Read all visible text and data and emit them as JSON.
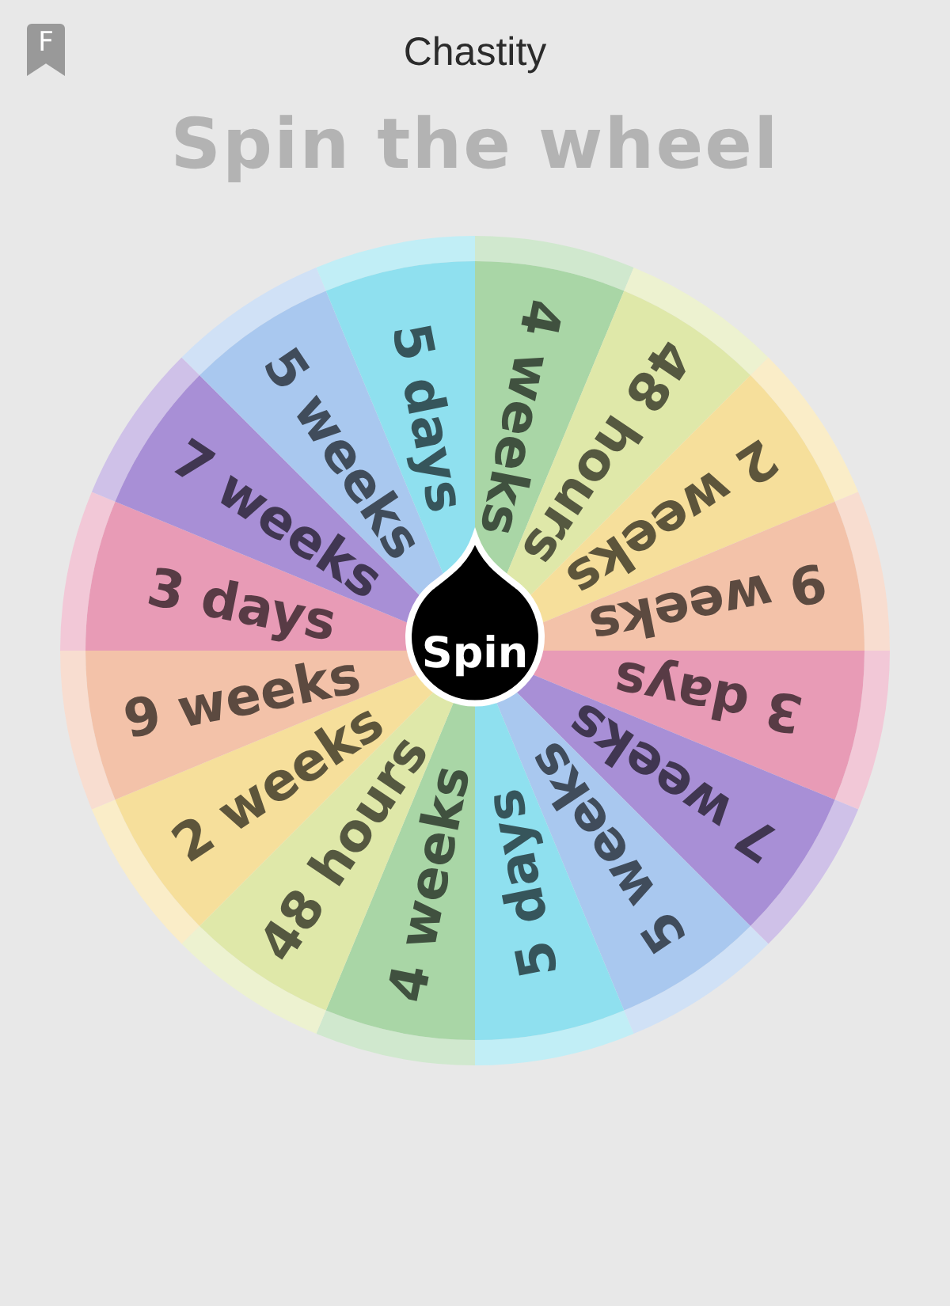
{
  "header": {
    "badge": "F",
    "title": "Chastity"
  },
  "heading": "Spin the wheel",
  "wheel": {
    "button": "Spin",
    "segments": [
      {
        "label": "4 weeks",
        "color": "#a9d6a6"
      },
      {
        "label": "48 hours",
        "color": "#dfe8a9"
      },
      {
        "label": "2 weeks",
        "color": "#f6df9b"
      },
      {
        "label": "9 weeks",
        "color": "#f3c2a9"
      },
      {
        "label": "3 days",
        "color": "#e89bb6"
      },
      {
        "label": "7 weeks",
        "color": "#a88fd6"
      },
      {
        "label": "5 weeks",
        "color": "#a9c8ef"
      },
      {
        "label": "5 days",
        "color": "#8fe0ef"
      },
      {
        "label": "4 weeks",
        "color": "#a9d6a6"
      },
      {
        "label": "48 hours",
        "color": "#dfe8a9"
      },
      {
        "label": "2 weeks",
        "color": "#f6df9b"
      },
      {
        "label": "9 weeks",
        "color": "#f3c2a9"
      },
      {
        "label": "3 days",
        "color": "#e89bb6"
      },
      {
        "label": "7 weeks",
        "color": "#a88fd6"
      },
      {
        "label": "5 weeks",
        "color": "#a9c8ef"
      },
      {
        "label": "5 days",
        "color": "#8fe0ef"
      }
    ]
  }
}
